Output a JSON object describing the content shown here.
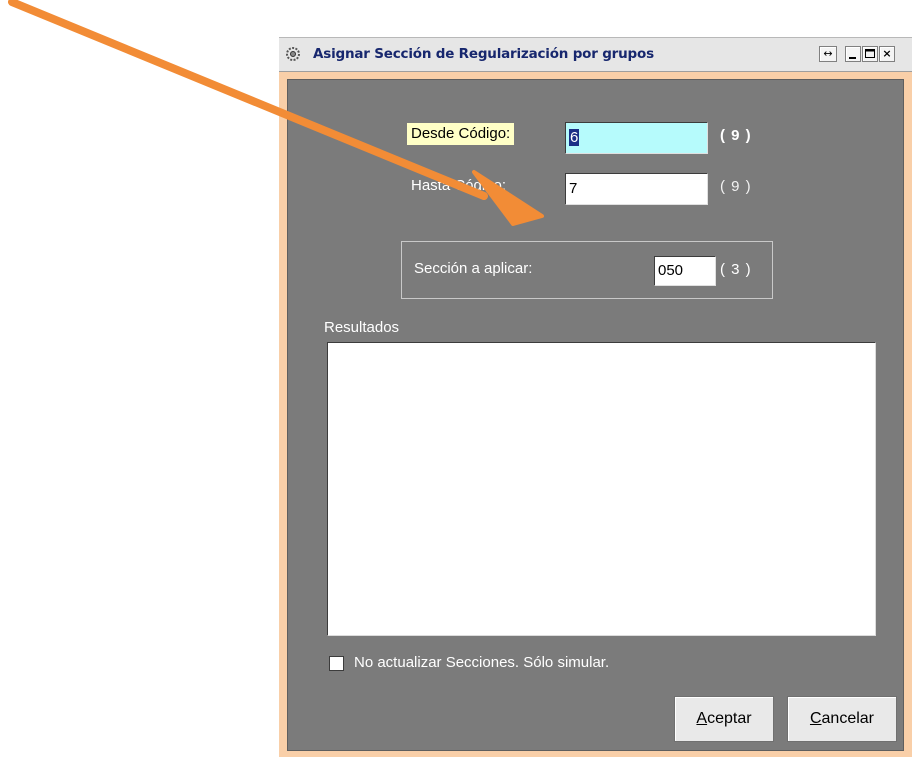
{
  "window": {
    "title": "Asignar Sección de Regularización por grupos",
    "icons": {
      "app": "gear-app-icon",
      "resize": "double-arrow-icon",
      "minimize": "minimize-icon",
      "maximize": "maximize-icon",
      "close": "close-icon"
    },
    "controls": {
      "resize": "↔",
      "close": "×"
    }
  },
  "form": {
    "desde": {
      "label": "Desde Código:",
      "value": "6",
      "hint": "( 9 )"
    },
    "hasta": {
      "label": "Hasta Código:",
      "value": "7",
      "hint": "( 9 )"
    },
    "seccion": {
      "label": "Sección a aplicar:",
      "value": "050",
      "hint": "( 3 )"
    },
    "results_label": "Resultados",
    "checkbox_label": "No actualizar Secciones. Sólo simular.",
    "checkbox_checked": false
  },
  "buttons": {
    "aceptar": {
      "mnemonic": "A",
      "rest": "ceptar"
    },
    "cancelar": {
      "mnemonic": "C",
      "rest": "ancelar"
    }
  },
  "colors": {
    "client_bg": "#7b7b7b",
    "frame": "#f9cfa8",
    "desde_input_bg": "#b6fbfc",
    "desde_label_bg": "#ffffc6",
    "title_text": "#17276e",
    "annotation_arrow": "#f28c36"
  }
}
